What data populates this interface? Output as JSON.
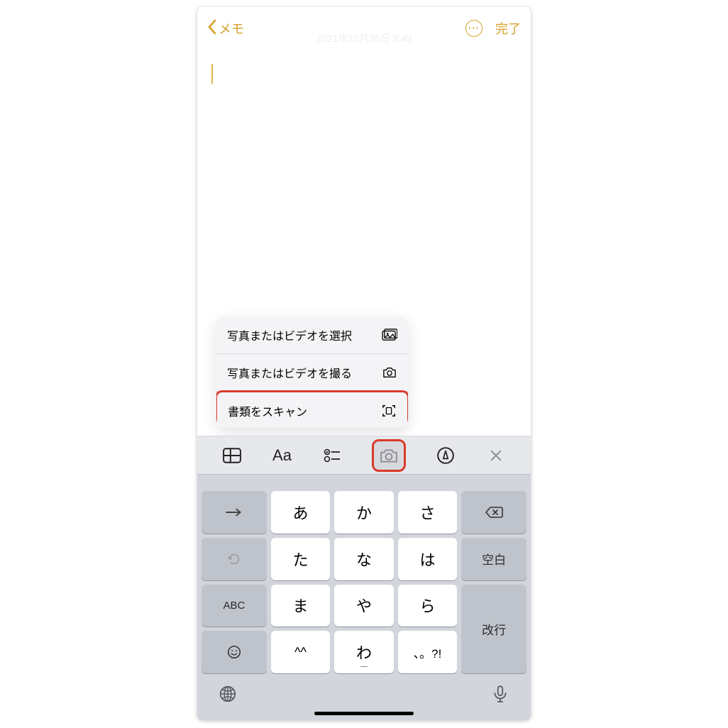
{
  "nav": {
    "back_label": "メモ",
    "done_label": "完了"
  },
  "note": {
    "timestamp": "2021年12月26日 9:49"
  },
  "context_menu": {
    "select_media": "写真またはビデオを選択",
    "take_media": "写真またはビデオを撮る",
    "scan_docs": "書類をスキャン"
  },
  "toolbar": {
    "format_label": "Aa"
  },
  "keyboard": {
    "rows": {
      "r1c2": "あ",
      "r1c3": "か",
      "r1c4": "さ",
      "r2c2": "た",
      "r2c3": "な",
      "r2c4": "は",
      "r3c2": "ま",
      "r3c3": "や",
      "r3c4": "ら",
      "r4c2": "^^",
      "r4c3": "わ",
      "r4c4": "、。?!"
    },
    "space": "空白",
    "abc": "ABC",
    "return": "改行"
  }
}
